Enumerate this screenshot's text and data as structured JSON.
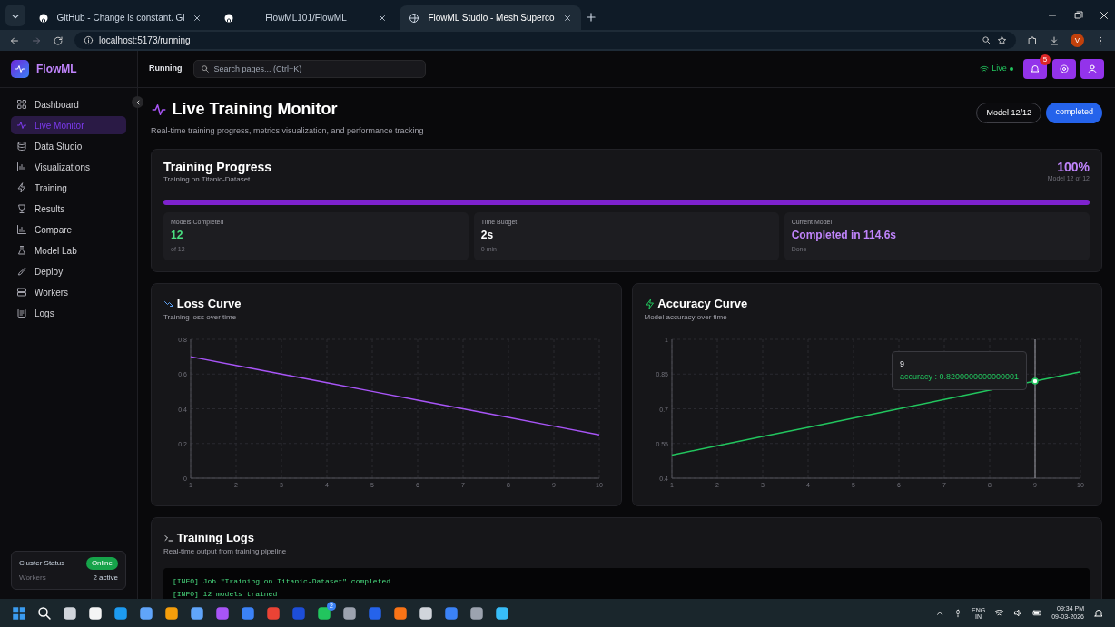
{
  "browser": {
    "tabs": [
      {
        "title": "GitHub - Change is constant. Gi",
        "selected": false,
        "kind": "github"
      },
      {
        "title": "FlowML101/FlowML",
        "selected": false,
        "kind": "github"
      },
      {
        "title": "FlowML Studio - Mesh Superco",
        "selected": true,
        "kind": "globe"
      }
    ],
    "url": "localhost:5173/running",
    "profile_initial": "V"
  },
  "topbar": {
    "brand": "FlowML",
    "breadcrumb": "Running",
    "search": {
      "placeholder": "Search pages... (Ctrl+K)"
    },
    "live": "Live",
    "notifications": "5"
  },
  "sidebar": {
    "items": [
      {
        "label": "Dashboard",
        "selected": false
      },
      {
        "label": "Live Monitor",
        "selected": true
      },
      {
        "label": "Data Studio",
        "selected": false
      },
      {
        "label": "Visualizations",
        "selected": false
      },
      {
        "label": "Training",
        "selected": false
      },
      {
        "label": "Results",
        "selected": false
      },
      {
        "label": "Compare",
        "selected": false
      },
      {
        "label": "Model Lab",
        "selected": false
      },
      {
        "label": "Deploy",
        "selected": false
      },
      {
        "label": "Workers",
        "selected": false
      },
      {
        "label": "Logs",
        "selected": false
      }
    ],
    "cluster": {
      "label": "Cluster Status",
      "status": "Online",
      "workers_label": "Workers",
      "workers": "2 active"
    }
  },
  "header": {
    "title": "Live Training Monitor",
    "subtitle": "Real-time training progress, metrics visualization, and performance tracking",
    "model_badge": "Model 12/12",
    "status": "completed"
  },
  "progress": {
    "title": "Training Progress",
    "subtitle": "Training on Titanic-Dataset",
    "percent": "100%",
    "model_of": "Model 12 of 12",
    "level": 1,
    "stats": [
      {
        "label": "Models Completed",
        "value": "12",
        "note": "of 12",
        "kind": "count"
      },
      {
        "label": "Time Budget",
        "value": "2s",
        "note": "0 min",
        "kind": "time"
      },
      {
        "label": "Current Model",
        "value": "Completed in 114.6s",
        "note": "Done",
        "kind": "model"
      }
    ]
  },
  "charts": [
    {
      "title": "Loss Curve",
      "subtitle": "Training loss over time",
      "kind": "loss",
      "chart_data": {
        "type": "line",
        "x": [
          1,
          2,
          3,
          4,
          5,
          6,
          7,
          8,
          9,
          10
        ],
        "grid": true,
        "series": [
          {
            "color": "#a855f7",
            "values": [
              0.7,
              0.65,
              0.6,
              0.55,
              0.5,
              0.45,
              0.4,
              0.35,
              0.3,
              0.25
            ]
          }
        ],
        "xlim": [
          1,
          10
        ],
        "ylim": [
          0,
          0.8
        ],
        "xticks": [
          1,
          2,
          3,
          4,
          5,
          6,
          7,
          8,
          9,
          10
        ],
        "yticks": [
          0,
          0.2,
          0.4,
          0.6,
          0.8
        ]
      }
    },
    {
      "title": "Accuracy Curve",
      "subtitle": "Model accuracy over time",
      "kind": "accuracy",
      "chart_data": {
        "type": "line",
        "x": [
          1,
          2,
          3,
          4,
          5,
          6,
          7,
          8,
          9,
          10
        ],
        "grid": true,
        "series": [
          {
            "name": "accuracy",
            "color": "#22c55e",
            "values": [
              0.5,
              0.54,
              0.58,
              0.62,
              0.66,
              0.7,
              0.74,
              0.78,
              0.82,
              0.86
            ]
          }
        ],
        "xlim": [
          1,
          10
        ],
        "ylim": [
          0.4,
          1
        ],
        "xticks": [
          1,
          2,
          3,
          4,
          5,
          6,
          7,
          8,
          9,
          10
        ],
        "yticks": [
          0.4,
          0.55,
          0.7,
          0.85,
          1
        ],
        "ref_lines": [
          {
            "axis": "x",
            "value": 9
          }
        ]
      },
      "tooltip": {
        "label": "9",
        "separator": ":",
        "value": "0.8200000000000001"
      }
    }
  ],
  "logs": {
    "title": "Training Logs",
    "subtitle": "Real-time output from training pipeline",
    "lines": [
      "[INFO] Job \"Training on Titanic-Dataset\" completed",
      "[INFO] 12 models trained"
    ]
  },
  "taskbar": {
    "badge": "2",
    "language": "ENG",
    "region": "IN",
    "time": "09:34 PM",
    "date": "09-03-2026"
  }
}
